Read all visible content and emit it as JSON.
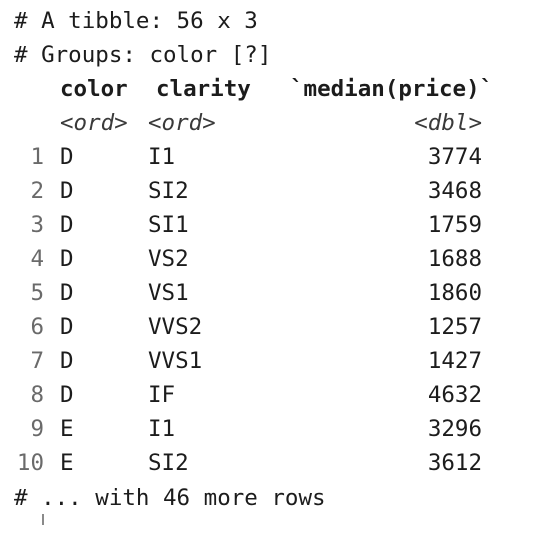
{
  "header": {
    "tibble_line": "# A tibble: 56 x 3",
    "groups_line": "# Groups: color [?]"
  },
  "columns": {
    "names": [
      "color",
      "clarity",
      "`median(price)`"
    ],
    "types": [
      "<ord>",
      "<ord>",
      "<dbl>"
    ]
  },
  "rows": [
    {
      "n": "1",
      "color": "D",
      "clarity": "I1",
      "price": "3774"
    },
    {
      "n": "2",
      "color": "D",
      "clarity": "SI2",
      "price": "3468"
    },
    {
      "n": "3",
      "color": "D",
      "clarity": "SI1",
      "price": "1759"
    },
    {
      "n": "4",
      "color": "D",
      "clarity": "VS2",
      "price": "1688"
    },
    {
      "n": "5",
      "color": "D",
      "clarity": "VS1",
      "price": "1860"
    },
    {
      "n": "6",
      "color": "D",
      "clarity": "VVS2",
      "price": "1257"
    },
    {
      "n": "7",
      "color": "D",
      "clarity": "VVS1",
      "price": "1427"
    },
    {
      "n": "8",
      "color": "D",
      "clarity": "IF",
      "price": "4632"
    },
    {
      "n": "9",
      "color": "E",
      "clarity": "I1",
      "price": "3296"
    },
    {
      "n": "10",
      "color": "E",
      "clarity": "SI2",
      "price": "3612"
    }
  ],
  "footer": {
    "more_rows": "# ... with 46 more rows"
  }
}
